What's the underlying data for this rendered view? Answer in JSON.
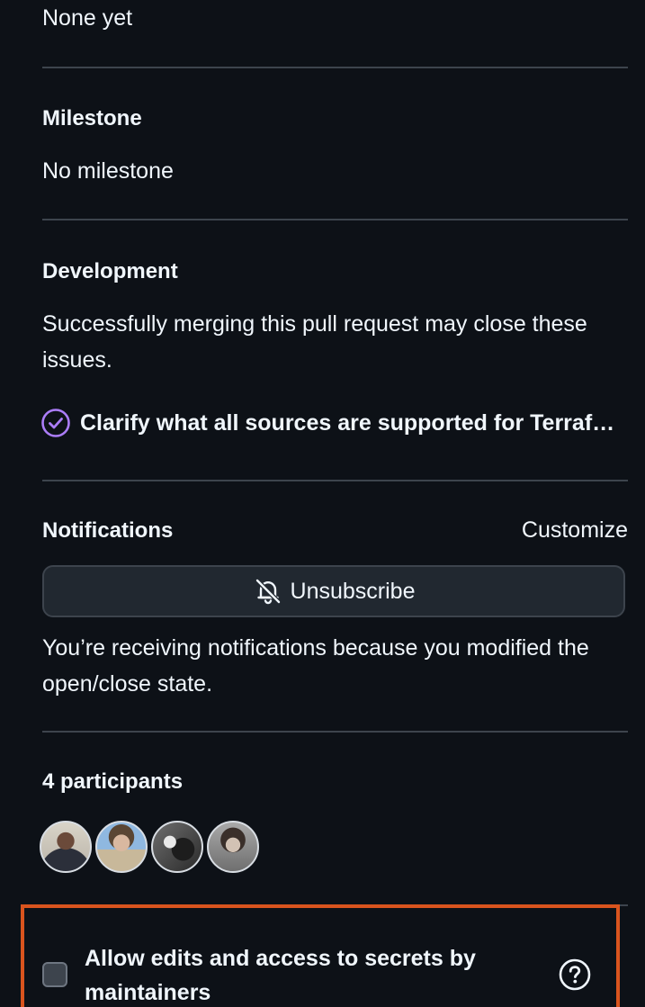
{
  "projects": {
    "value": "None yet"
  },
  "milestone": {
    "heading": "Milestone",
    "value": "No milestone"
  },
  "development": {
    "heading": "Development",
    "description": "Successfully merging this pull request may close these issues.",
    "linked_issue": {
      "title": "Clarify what all sources are supported for Terraform modules",
      "icon": "issue-closed-check-icon",
      "color": "#ab7df8"
    }
  },
  "notifications": {
    "heading": "Notifications",
    "customize_label": "Customize",
    "unsubscribe_label": "Unsubscribe",
    "unsubscribe_icon": "bell-slash-icon",
    "reason": "You’re receiving notifications because you modified the open/close state."
  },
  "participants": {
    "heading": "4 participants",
    "avatars": [
      "avatar-1",
      "avatar-2",
      "avatar-3",
      "avatar-4"
    ]
  },
  "maintainer_edits": {
    "label": "Allow edits and access to secrets by maintainers",
    "checked": false,
    "help_icon": "question-circle-icon",
    "highlight_color": "#d9541e"
  },
  "colors": {
    "background": "#0d1117",
    "text": "#f0f6fc",
    "divider": "#3d444d",
    "button_bg": "#212830"
  }
}
